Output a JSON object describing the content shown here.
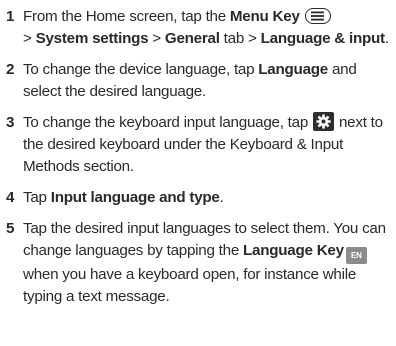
{
  "steps": [
    {
      "number": "1",
      "t1": "From the Home screen, tap the ",
      "b1": "Menu Key",
      "icon1": "menu-key-icon",
      "t2": " > ",
      "b2": "System settings",
      "t3": " > ",
      "b3": "General",
      "t4": " tab > ",
      "b4": "Language & input",
      "t5": "."
    },
    {
      "number": "2",
      "t1": "To change the device language, tap ",
      "b1": "Language",
      "t2": " and select the desired language."
    },
    {
      "number": "3",
      "t1": "To change the keyboard input language, tap ",
      "icon1": "gear-icon",
      "t2": " next to the desired keyboard under the Keyboard & Input Methods section."
    },
    {
      "number": "4",
      "t1": "Tap ",
      "b1": "Input language and type",
      "t2": "."
    },
    {
      "number": "5",
      "t1": "Tap the desired input languages to select them. You can change languages by tapping the ",
      "b1": "Language Key",
      "icon1": "language-key-icon",
      "icon1_text": "EN",
      "t2": " when you have a keyboard open, for instance while typing a text message."
    }
  ]
}
